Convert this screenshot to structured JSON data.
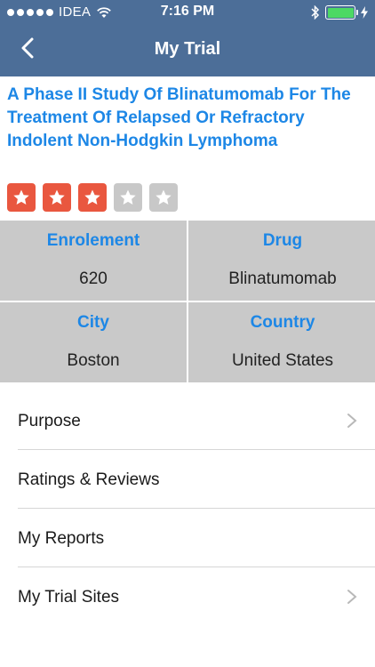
{
  "status_bar": {
    "carrier": "IDEA",
    "time": "7:16 PM"
  },
  "nav": {
    "title": "My Trial"
  },
  "trial": {
    "title": "A Phase II Study Of Blinatumomab For The Treatment Of Relapsed Or Refractory Indolent Non-Hodgkin Lymphoma",
    "rating": 3,
    "rating_max": 5
  },
  "colors": {
    "header_bg": "#4c6e98",
    "accent": "#1d87e6",
    "star_on": "#e9573f",
    "star_off": "#c8c8c8",
    "cell_bg": "#c9c9c9"
  },
  "details": [
    {
      "label": "Enrolement",
      "value": "620"
    },
    {
      "label": "Drug",
      "value": "Blinatumomab"
    },
    {
      "label": "City",
      "value": "Boston"
    },
    {
      "label": "Country",
      "value": "United States"
    }
  ],
  "menu": [
    {
      "label": "Purpose",
      "chevron": true
    },
    {
      "label": "Ratings & Reviews",
      "chevron": false
    },
    {
      "label": "My Reports",
      "chevron": false
    },
    {
      "label": "My Trial Sites",
      "chevron": true
    }
  ]
}
